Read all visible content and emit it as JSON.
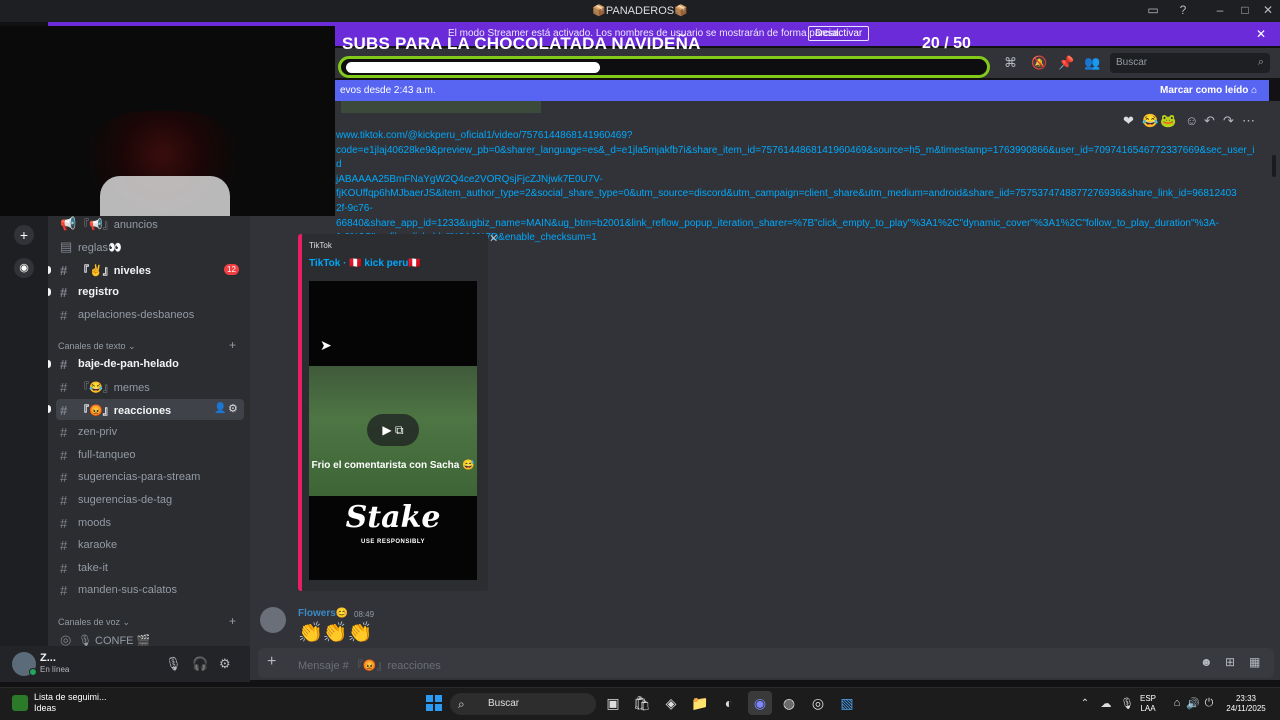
{
  "window": {
    "title": "📦PANADEROS📦"
  },
  "streamer": {
    "text": "El modo Streamer está activado. Los nombres de usuario se mostrarán de forma parcial.",
    "button": "Desactivar"
  },
  "goal": {
    "title": "SUBS PARA LA CHOCOLATADA NAVIDEÑA",
    "count": "20 / 50",
    "progress": 0.4
  },
  "header": {
    "search_placeholder": "Buscar"
  },
  "newbar": {
    "text": "evos desde 2:43 a.m.",
    "mark_read": "Marcar como leído"
  },
  "sidebar": {
    "channels": [
      {
        "label": "『📢』anuncios",
        "bold": false
      },
      {
        "label": "reglas👀",
        "bold": false
      },
      {
        "label": "『✌』niveles",
        "bold": true,
        "badge": "12"
      },
      {
        "label": "registro",
        "bold": true
      },
      {
        "label": "apelaciones-desbaneos",
        "bold": false
      }
    ],
    "text_category": "Canales de texto",
    "text_channels": [
      {
        "label": "baje-de-pan-helado",
        "bold": true
      },
      {
        "label": "『😂』memes",
        "bold": false
      },
      {
        "label": "『😡』reacciones",
        "bold": true,
        "selected": true
      },
      {
        "label": "zen-priv",
        "bold": false
      },
      {
        "label": "full-tanqueo",
        "bold": false
      },
      {
        "label": "sugerencias-para-stream",
        "bold": false
      },
      {
        "label": "sugerencias-de-tag",
        "bold": false
      },
      {
        "label": "moods",
        "bold": false
      },
      {
        "label": "karaoke",
        "bold": false
      },
      {
        "label": "take-it",
        "bold": false
      },
      {
        "label": "manden-sus-calatos",
        "bold": false
      }
    ],
    "voice_category": "Canales de voz",
    "voice_channels": [
      {
        "label": "🎙 CONFE 🎬"
      }
    ]
  },
  "message": {
    "link_lines": [
      "www.tiktok.com/@kickperu_oficial1/video/7576144868141960469?",
      "code=e1jlaj40628ke9&preview_pb=0&sharer_language=es&_d=e1jla5mjakfb7i&share_item_id=7576144868141960469&source=h5_m&timestamp=1763990866&user_id=7097416546772337669&sec_user_id",
      "jABAAAA25BmFNaYgW2Q4ce2VORQsjFjcZJNjwk7E0U7V-",
      "fjKOUffqp6hMJbaerJS&item_author_type=2&social_share_type=0&utm_source=discord&utm_campaign=client_share&utm_medium=android&share_iid=7575374748877276936&share_link_id=96812403",
      "2f-9c76-",
      "66840&share_app_id=1233&ugbiz_name=MAIN&ug_btm=b2001&link_reflow_popup_iteration_sharer=%7B\"click_empty_to_play\"%3A1%2C\"dynamic_cover\"%3A1%2C\"follow_to_play_duration\"%3A-",
      "1.0%2C\"profile_clickable\"%3A1%7D&enable_checksum=1"
    ],
    "embed": {
      "provider": "TikTok",
      "title": "TikTok · 🇵🇪 kick peru🇵🇪",
      "caption": "Frio el comentarista con Sacha 😅",
      "sponsor": "Stake",
      "sponsor_sub": "USE RESPONSIBLY"
    }
  },
  "next_message": {
    "author": "Flowers😊",
    "time": "08:49",
    "content": "👏👏👏"
  },
  "composer": {
    "placeholder": "Mensaje # 『😡』reacciones"
  },
  "user": {
    "name": "Z...",
    "status": "En línea"
  },
  "taskbar": {
    "news_title": "Lista de seguimi...",
    "news_sub": "Ideas",
    "search": "Buscar",
    "lang": "ESP",
    "lang2": "LAA",
    "time": "23:33",
    "date": "24/11/2025"
  },
  "colors": {
    "accent": "#5865f2",
    "streamer": "#6c2bd9",
    "goal_border": "#83c91a",
    "embed_bar": "#e91e63"
  }
}
